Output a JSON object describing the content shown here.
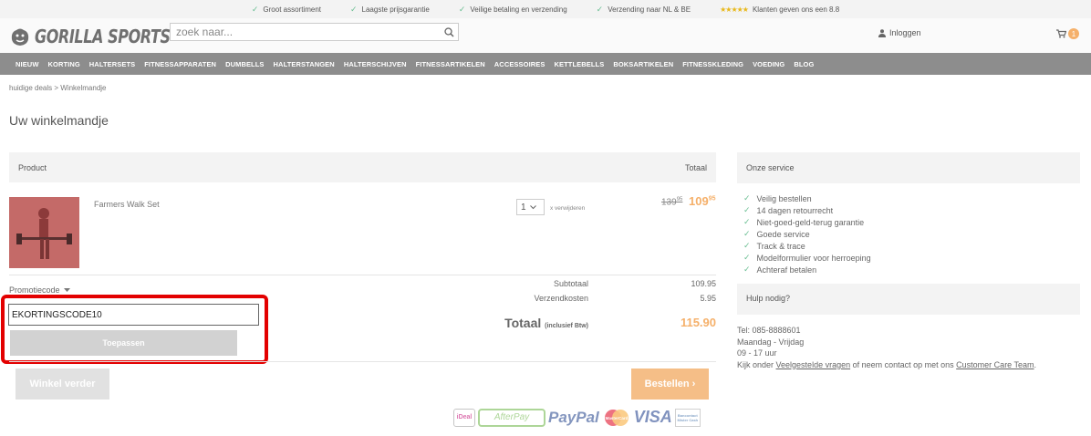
{
  "topbar": {
    "usps": [
      "Groot assortiment",
      "Laagste prijsgarantie",
      "Veilige betaling en verzending",
      "Verzending naar NL & BE"
    ],
    "stars": "★★★★★",
    "rating_text": "Klanten geven ons een 8.8"
  },
  "header": {
    "logo_text": "GORILLA SPORTS",
    "search_placeholder": "zoek naar...",
    "login_label": "Inloggen",
    "cart_count": "1"
  },
  "nav": {
    "items": [
      "NIEUW",
      "KORTING",
      "HALTERSETS",
      "FITNESSAPPARATEN",
      "DUMBELLS",
      "HALTERSTANGEN",
      "HALTERSCHIJVEN",
      "FITNESSARTIKELEN",
      "ACCESSOIRES",
      "KETTLEBELLS",
      "BOKSARTIKELEN",
      "FITNESSKLEDING",
      "VOEDING",
      "BLOG"
    ]
  },
  "breadcrumb": "huidige deals > Winkelmandje",
  "page_title": "Uw winkelmandje",
  "cart": {
    "col_product": "Product",
    "col_total": "Totaal",
    "item": {
      "name": "Farmers Walk Set",
      "quantity": "1",
      "remove_label": "x verwijderen",
      "old_price": "139",
      "old_price_cents": "95",
      "new_price": "109",
      "new_price_cents": "95"
    },
    "promo_label": "Promotiecode",
    "promo_value": "EKORTINGSCODE10",
    "apply_label": "Toepassen",
    "subtotal_label": "Subtotaal",
    "subtotal_value": "109.95",
    "shipping_label": "Verzendkosten",
    "shipping_value": "5.95",
    "total_label": "Totaal",
    "total_suffix": "(inclusief Btw)",
    "total_value": "115.90",
    "continue_label": "Winkel verder",
    "order_label": "Bestellen"
  },
  "payments": {
    "ideal": "iDeal",
    "afterpay": "AfterPay",
    "paypal": "PayPal",
    "mastercard": "MasterCard",
    "visa": "VISA",
    "bank": "Bancontact Mister Cash"
  },
  "service": {
    "title": "Onze service",
    "items": [
      "Veilig bestellen",
      "14 dagen retourrecht",
      "Niet-goed-geld-terug garantie",
      "Goede service",
      "Track & trace",
      "Modelformulier voor herroeping",
      "Achteraf betalen"
    ]
  },
  "help": {
    "title": "Hulp nodig?",
    "phone": "Tel: 085-8888601",
    "days": "Maandag - Vrijdag",
    "hours": "09 - 17 uur",
    "text_before": "Kijk onder ",
    "faq_link": "Veelgestelde vragen",
    "text_middle": " of neem contact op met ons ",
    "cc_link": "Customer Care Team",
    "text_after": "."
  },
  "colors": {
    "accent_orange": "#f5b06a",
    "nav_gray": "#8d8d8d",
    "highlight_red": "#e30000",
    "check_green": "#6bbf93"
  }
}
